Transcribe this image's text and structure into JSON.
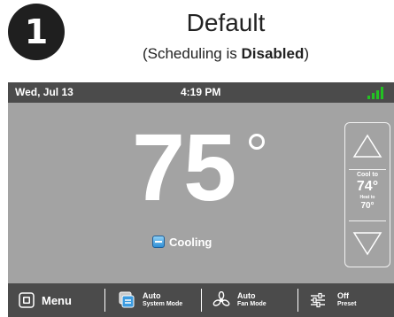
{
  "header": {
    "step_number": "1",
    "title": "Default",
    "subtitle_prefix": "(Scheduling is ",
    "subtitle_bold": "Disabled",
    "subtitle_suffix": ")"
  },
  "status_bar": {
    "date": "Wed, Jul 13",
    "time": "4:19 PM",
    "signal_icon": "signal-strength-icon",
    "signal_color": "#22c122"
  },
  "main": {
    "current_temp": "75",
    "mode_label": "Cooling",
    "mode_icon": "cooling-icon"
  },
  "setpoints": {
    "cool_label": "Cool to",
    "cool_value": "74°",
    "heat_label": "Heat to",
    "heat_value": "70°",
    "up_icon": "arrow-up-icon",
    "down_icon": "arrow-down-icon"
  },
  "bottom_bar": {
    "menu_label": "Menu",
    "system_mode_value": "Auto",
    "system_mode_caption": "System Mode",
    "fan_mode_value": "Auto",
    "fan_mode_caption": "Fan Mode",
    "preset_value": "Off",
    "preset_caption": "Preset"
  },
  "colors": {
    "screen_bg": "#a3a3a3",
    "bar_bg": "#4b4b4b",
    "badge_bg": "#1f1f1f"
  }
}
